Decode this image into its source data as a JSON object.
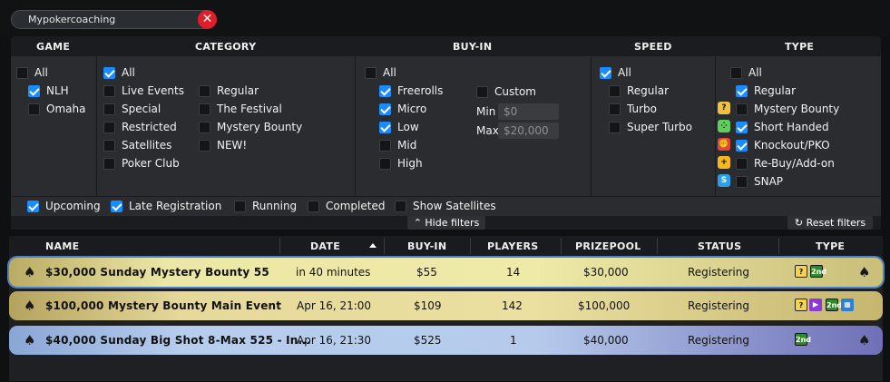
{
  "search": {
    "value": "Mypokercoaching"
  },
  "filters": {
    "headers": {
      "game": "GAME",
      "category": "CATEGORY",
      "buyin": "BUY-IN",
      "speed": "SPEED",
      "type": "TYPE"
    },
    "game": [
      {
        "label": "All",
        "checked": false
      },
      {
        "label": "NLH",
        "checked": true
      },
      {
        "label": "Omaha",
        "checked": false
      }
    ],
    "category_left": [
      {
        "label": "All",
        "checked": true
      },
      {
        "label": "Live Events",
        "checked": false
      },
      {
        "label": "Special",
        "checked": false
      },
      {
        "label": "Restricted",
        "checked": false
      },
      {
        "label": "Satellites",
        "checked": false
      },
      {
        "label": "Poker Club",
        "checked": false
      }
    ],
    "category_right": [
      {
        "label": "Regular",
        "checked": false
      },
      {
        "label": "The Festival",
        "checked": false
      },
      {
        "label": "Mystery Bounty",
        "checked": false
      },
      {
        "label": "NEW!",
        "checked": false
      }
    ],
    "buyin": [
      {
        "label": "All",
        "checked": false
      },
      {
        "label": "Freerolls",
        "checked": true
      },
      {
        "label": "Micro",
        "checked": true
      },
      {
        "label": "Low",
        "checked": true
      },
      {
        "label": "Mid",
        "checked": false
      },
      {
        "label": "High",
        "checked": false
      }
    ],
    "custom": {
      "label": "Custom",
      "checked": false,
      "min_label": "Min",
      "min_value": "$0",
      "max_label": "Max",
      "max_value": "$20,000"
    },
    "speed": [
      {
        "label": "All",
        "checked": true
      },
      {
        "label": "Regular",
        "checked": false
      },
      {
        "label": "Turbo",
        "checked": false
      },
      {
        "label": "Super Turbo",
        "checked": false
      }
    ],
    "type": [
      {
        "label": "All",
        "checked": false,
        "icon": ""
      },
      {
        "label": "Regular",
        "checked": true,
        "icon": ""
      },
      {
        "label": "Mystery Bounty",
        "checked": false,
        "icon": "mystery-bounty-icon"
      },
      {
        "label": "Short Handed",
        "checked": true,
        "icon": "short-handed-icon"
      },
      {
        "label": "Knockout/PKO",
        "checked": true,
        "icon": "knockout-icon"
      },
      {
        "label": "Re-Buy/Add-on",
        "checked": false,
        "icon": "rebuy-icon"
      },
      {
        "label": "SNAP",
        "checked": false,
        "icon": "snap-icon"
      }
    ],
    "status_row": [
      {
        "label": "Upcoming",
        "checked": true
      },
      {
        "label": "Late Registration",
        "checked": true
      },
      {
        "label": "Running",
        "checked": false
      },
      {
        "label": "Completed",
        "checked": false
      },
      {
        "label": "Show Satellites",
        "checked": false
      }
    ],
    "hide_label": "Hide filters",
    "reset_label": "Reset filters"
  },
  "table": {
    "columns": {
      "name": "NAME",
      "date": "DATE",
      "buyin": "BUY-IN",
      "players": "PLAYERS",
      "prizepool": "PRIZEPOOL",
      "status": "STATUS",
      "type": "TYPE"
    },
    "rows": [
      {
        "name": "$30,000 Sunday Mystery Bounty 55",
        "date": "in 40 minutes",
        "buyin": "$55",
        "players": "14",
        "prizepool": "$30,000",
        "status": "Registering"
      },
      {
        "name": "$100,000 Mystery Bounty Main Event",
        "date": "Apr 16, 21:00",
        "buyin": "$109",
        "players": "142",
        "prizepool": "$100,000",
        "status": "Registering"
      },
      {
        "name": "$40,000 Sunday Big Shot 8-Max 525 - In...",
        "date": "Apr 16, 21:30",
        "buyin": "$525",
        "players": "1",
        "prizepool": "$40,000",
        "status": "Registering"
      }
    ],
    "badge_2nd": "2nd"
  },
  "colors": {
    "accent": "#1a8cff",
    "clear": "#e01e2a"
  }
}
